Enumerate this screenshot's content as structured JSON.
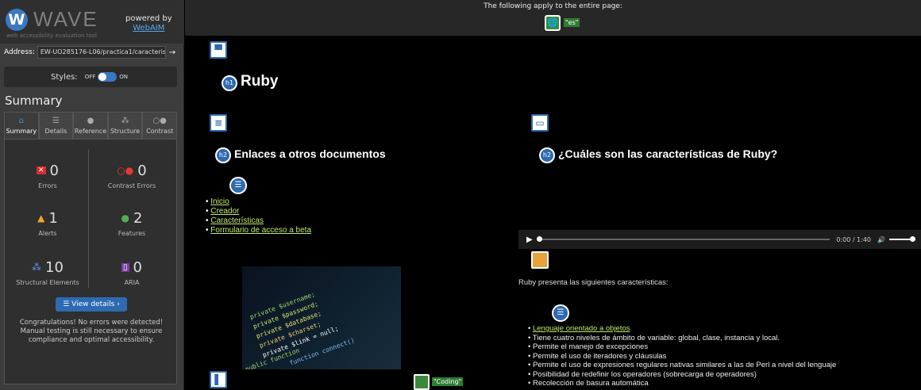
{
  "sidebar": {
    "logo_letter": "W",
    "logo_text": "WAVE",
    "logo_subtitle": "web accessibility evaluation tool",
    "powered_by": "powered by",
    "powered_link": "WebAIM",
    "address_label": "Address:",
    "address_value": "EW-UO285176-L06/practica1/caracteristicas",
    "styles_label": "Styles:",
    "styles_off": "OFF",
    "styles_on": "ON",
    "summary_title": "Summary",
    "tabs": [
      {
        "label": "Summary",
        "icon": "home-icon"
      },
      {
        "label": "Details",
        "icon": "list-icon"
      },
      {
        "label": "Reference",
        "icon": "info-icon"
      },
      {
        "label": "Structure",
        "icon": "hierarchy-icon"
      },
      {
        "label": "Contrast",
        "icon": "contrast-icon"
      }
    ],
    "stats": {
      "errors": {
        "count": "0",
        "label": "Errors"
      },
      "contrast_errors": {
        "count": "0",
        "label": "Contrast Errors"
      },
      "alerts": {
        "count": "1",
        "label": "Alerts"
      },
      "features": {
        "count": "2",
        "label": "Features"
      },
      "structural": {
        "count": "10",
        "label": "Structural Elements"
      },
      "aria": {
        "count": "0",
        "label": "ARIA"
      }
    },
    "view_details": "View details ›",
    "congrats": "Congratulations! No errors were detected! Manual testing is still necessary to ensure compliance and optimal accessibility."
  },
  "topbar": {
    "text": "The following apply to the entire page:",
    "lang_value": "\"es\""
  },
  "main": {
    "h1": "Ruby",
    "h1_badge": "h1",
    "h2_badge": "h2",
    "h2_links": "Enlaces a otros documentos",
    "h2_features": "¿Cuáles son las características de Ruby?",
    "links": [
      "Inicio",
      "Creador",
      "Características",
      "Formulario de acceso a beta"
    ],
    "image_alt": "\"Coding\"",
    "audio": {
      "time": "0:00 / 1:40"
    },
    "ruby_desc": "Ruby presenta las siguientes características:",
    "features": [
      "Lenguaje orientado a objetos",
      "Tiene cuatro niveles de ámbito de variable: global, clase, instancia y local.",
      "Permite el manejo de excepciones",
      "Permite el uso de iteradores y cláusulas",
      "Permite el uso de expresiones regulares nativas similares a las de Perl a nivel del lenguaje",
      "Posibilidad de redefinir los operadores (sobrecarga de operadores)",
      "Recolección de basura automática"
    ],
    "code_lines": [
      "private $username;",
      "private $password;",
      "private $database;",
      "private $charset;",
      "private $link = null;",
      "function connect()",
      "public function"
    ]
  }
}
